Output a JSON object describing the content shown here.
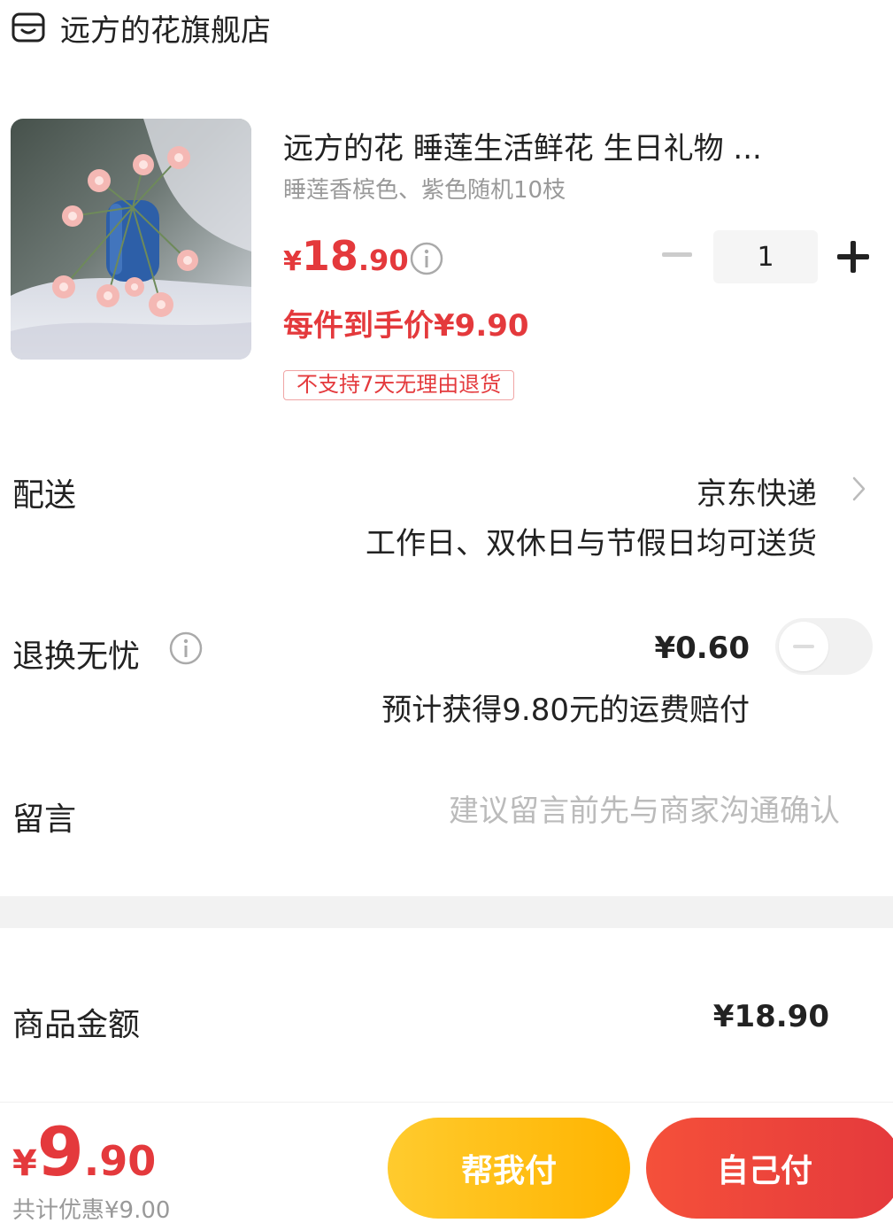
{
  "store": {
    "name": "远方的花旗舰店",
    "icon": "store-icon"
  },
  "product": {
    "title": "远方的花 睡莲生活鲜花 生日礼物 ...",
    "spec": "睡莲香槟色、紫色随机10枝",
    "price_yen": "¥",
    "price_int": "18",
    "price_dec": ".90",
    "per_item_price": "每件到手价¥9.90",
    "return_tag": "不支持7天无理由退货",
    "quantity": "1"
  },
  "delivery": {
    "label": "配送",
    "value": "京东快递",
    "sub": "工作日、双休日与节假日均可送货"
  },
  "refund": {
    "label": "退换无忧",
    "price": "¥0.60",
    "sub": "预计获得9.80元的运费赔付",
    "enabled": false
  },
  "message": {
    "label": "留言",
    "placeholder": "建议留言前先与商家沟通确认"
  },
  "amount": {
    "label": "商品金额",
    "value": "¥18.90"
  },
  "bottom": {
    "total_yen": "¥",
    "total_int": "9",
    "total_dec": ".90",
    "saving": "共计优惠¥9.00",
    "help_pay": "帮我付",
    "self_pay": "自己付"
  },
  "colors": {
    "accent_red": "#e4393c",
    "accent_yellow": "#ffbb00"
  }
}
